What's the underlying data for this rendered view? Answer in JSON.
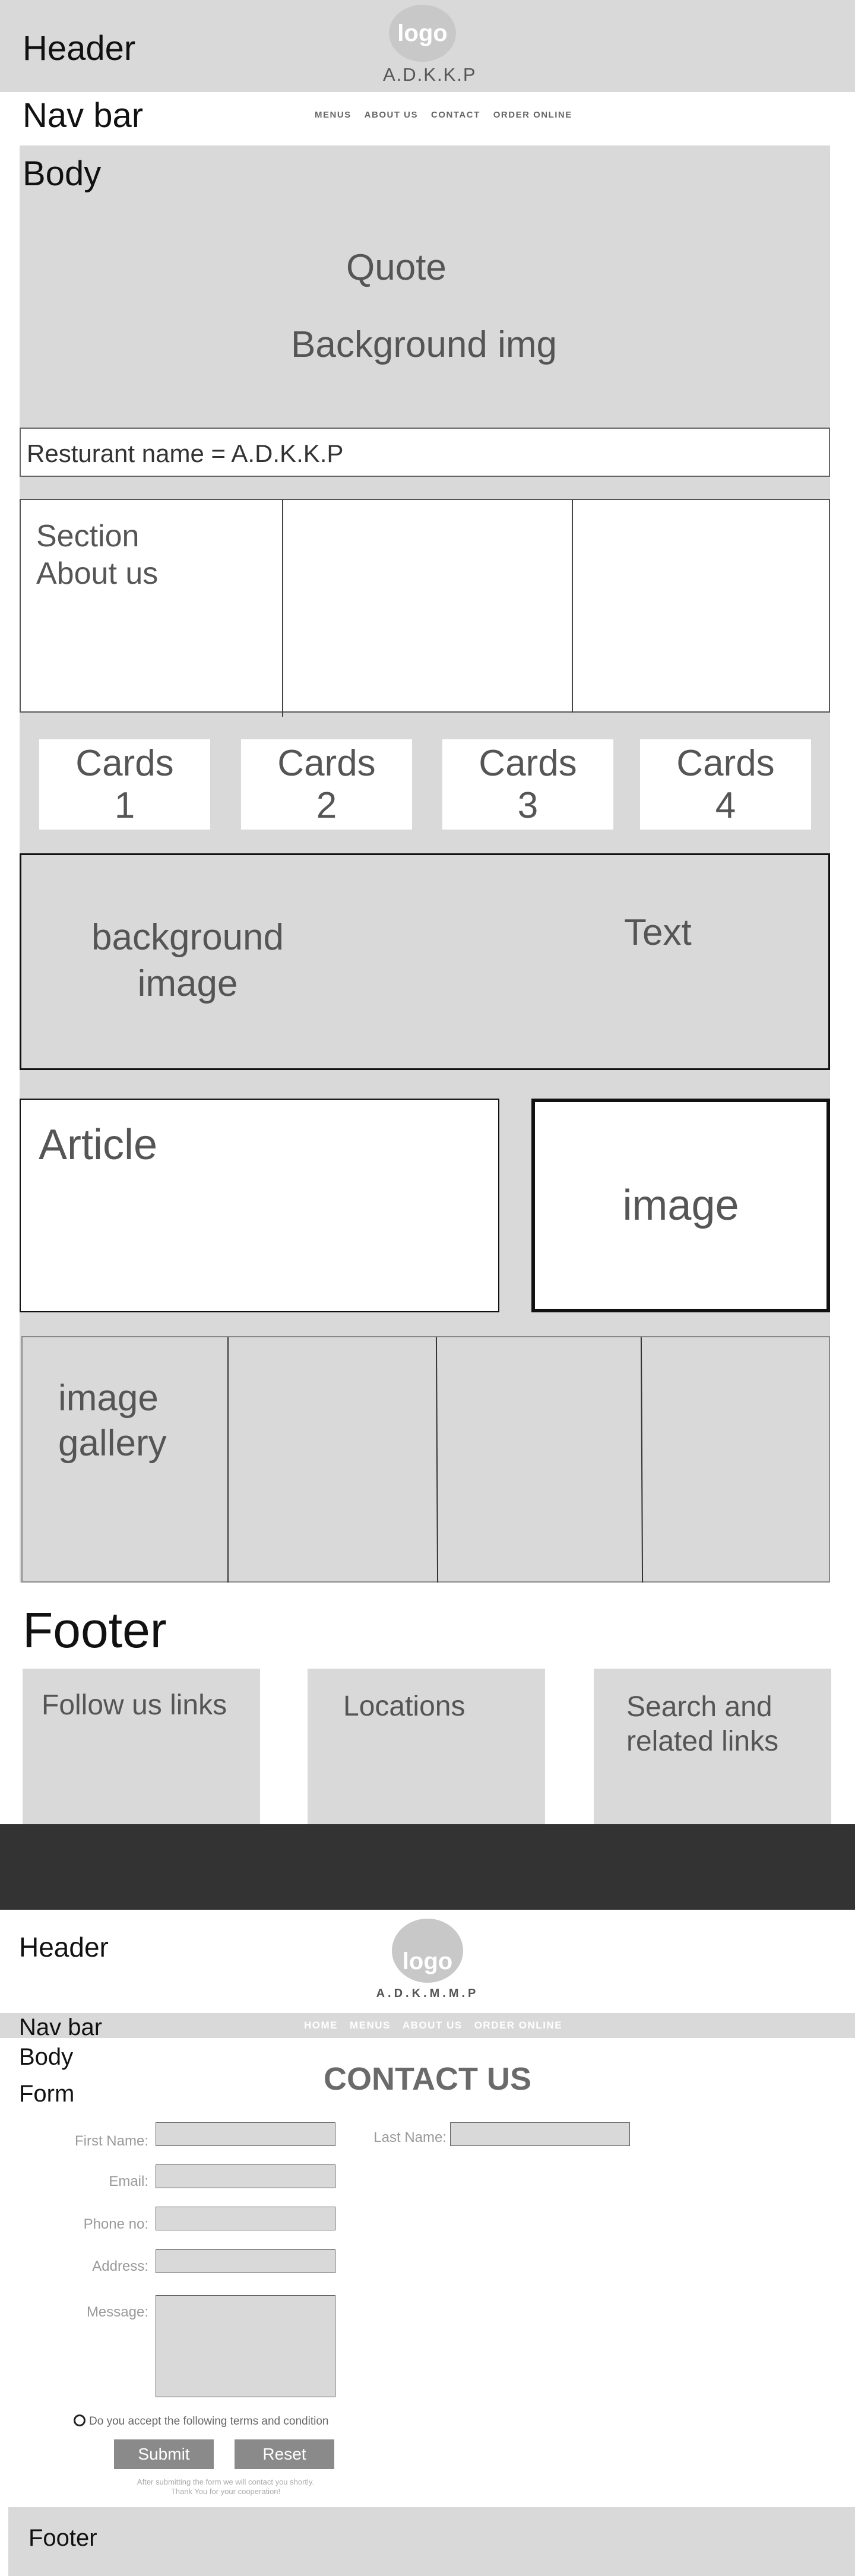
{
  "page1": {
    "header": {
      "label": "Header",
      "logo": "logo",
      "brand": "A.D.K.K.P"
    },
    "nav": {
      "label": "Nav bar",
      "items": [
        "MENUS",
        "ABOUT US",
        "CONTACT",
        "ORDER ONLINE"
      ]
    },
    "hero": {
      "label": "Body",
      "quote": "Quote",
      "background": "Background img"
    },
    "restaurant_name": "Resturant name = A.D.K.K.P",
    "about": {
      "title": "Section\nAbout us"
    },
    "cards": [
      "Cards\n1",
      "Cards\n2",
      "Cards\n3",
      "Cards\n4"
    ],
    "banner": {
      "image": "background\nimage",
      "text": "Text"
    },
    "article": {
      "title": "Article",
      "image": "image"
    },
    "gallery": {
      "title": "image\ngallery"
    },
    "footer": {
      "label": "Footer",
      "columns": [
        "Follow us links",
        "Locations",
        "Search and\nrelated links"
      ]
    }
  },
  "page2": {
    "header": {
      "label": "Header",
      "logo": "logo",
      "brand": "A.D.K.M.M.P"
    },
    "nav": {
      "label": "Nav bar",
      "items": [
        "HOME",
        "MENUS",
        "ABOUT US",
        "ORDER ONLINE"
      ]
    },
    "body_label": "Body",
    "form_label": "Form",
    "title": "CONTACT US",
    "fields": {
      "first_name": "First Name:",
      "last_name": "Last Name:",
      "email": "Email:",
      "phone": "Phone no:",
      "address": "Address:",
      "message": "Message:"
    },
    "terms": "Do you accept the following terms and condition",
    "submit": "Submit",
    "reset": "Reset",
    "note_line1": "After submitting the form we will contact you shortly.",
    "note_line2": "Thank You for your cooperation!",
    "footer_label": "Footer"
  },
  "colors": {
    "wireframe_gray": "#d9d9d9",
    "separator": "#333333",
    "button": "#8a8a8a"
  }
}
